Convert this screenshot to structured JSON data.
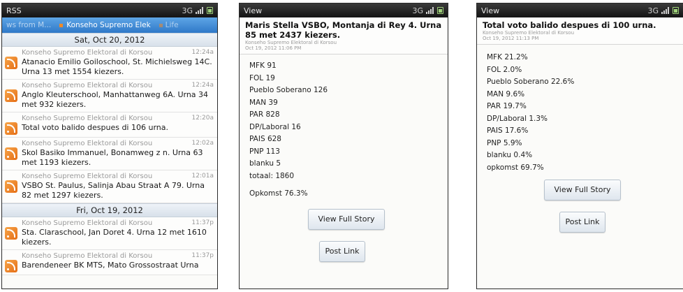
{
  "status": {
    "network": "3G"
  },
  "rss": {
    "title": "RSS",
    "tabs": {
      "prev": "ws from M...",
      "active": "Konseho Supremo Elek",
      "next": "Life"
    },
    "groups": [
      {
        "date": "Sat, Oct 20, 2012",
        "items": [
          {
            "source": "Konseho Supremo Elektoral di Korsou",
            "time": "12:24a",
            "title": "Atanacio Emilio Goiloschool, St. Michielsweg 14C. Urna 13 met 1554 kiezers."
          },
          {
            "source": "Konseho Supremo Elektoral di Korsou",
            "time": "12:24a",
            "title": "Anglo Kleuterschool, Manhattanweg 6A. Urna 34 met 932 kiezers."
          },
          {
            "source": "Konseho Supremo Elektoral di Korsou",
            "time": "12:20a",
            "title": "Total voto balido despues di 106 urna."
          },
          {
            "source": "Konseho Supremo Elektoral di Korsou",
            "time": "12:02a",
            "title": "Skol Basiko Immanuel, Bonamweg z n. Urna 63 met 1193 kiezers."
          },
          {
            "source": "Konseho Supremo Elektoral di Korsou",
            "time": "12:01a",
            "title": "VSBO St. Paulus, Salinja Abau Straat A 79. Urna 82 met 1297 kiezers."
          }
        ]
      },
      {
        "date": "Fri, Oct 19, 2012",
        "items": [
          {
            "source": "Konseho Supremo Elektoral di Korsou",
            "time": "11:37p",
            "title": "Sta. Claraschool, Jan Doret 4. Urna 12 met 1610 kiezers."
          },
          {
            "source": "Konseho Supremo Elektoral di Korsou",
            "time": "11:37p",
            "title": "Barendeneer BK MTS, Mato Grossostraat Urna"
          }
        ]
      }
    ]
  },
  "view1": {
    "title": "View",
    "headline": "Maris Stella VSBO, Montanja di Rey 4. Urna 85 met 2437 kiezers.",
    "source": "Konseho Supremo Elektoral di Korsou",
    "timestamp": "Oct 19, 2012 11:06 PM",
    "results": [
      "MFK 91",
      "FOL 19",
      "Pueblo Soberano 126",
      "MAN 39",
      "PAR 828",
      "DP/Laboral 16",
      "PAIS 628",
      "PNP 113",
      "blanku 5",
      "totaal: 1860"
    ],
    "turnout": "Opkomst 76.3%",
    "view_full_story": "View Full Story",
    "post_link": "Post Link"
  },
  "view2": {
    "title": "View",
    "headline": "Total voto balido despues di 100 urna.",
    "source": "Konseho Supremo Elektoral di Korsou",
    "timestamp": "Oct 19, 2012 11:13 PM",
    "results": [
      "MFK 21.2%",
      "FOL 2.0%",
      "Pueblo Soberano 22.6%",
      "MAN 9.6%",
      "PAR 19.7%",
      "DP/Laboral 1.3%",
      "PAIS 17.6%",
      "PNP 5.9%",
      "blanku 0.4%",
      "opkomst 69.7%"
    ],
    "view_full_story": "View Full Story",
    "post_link": "Post Link"
  }
}
